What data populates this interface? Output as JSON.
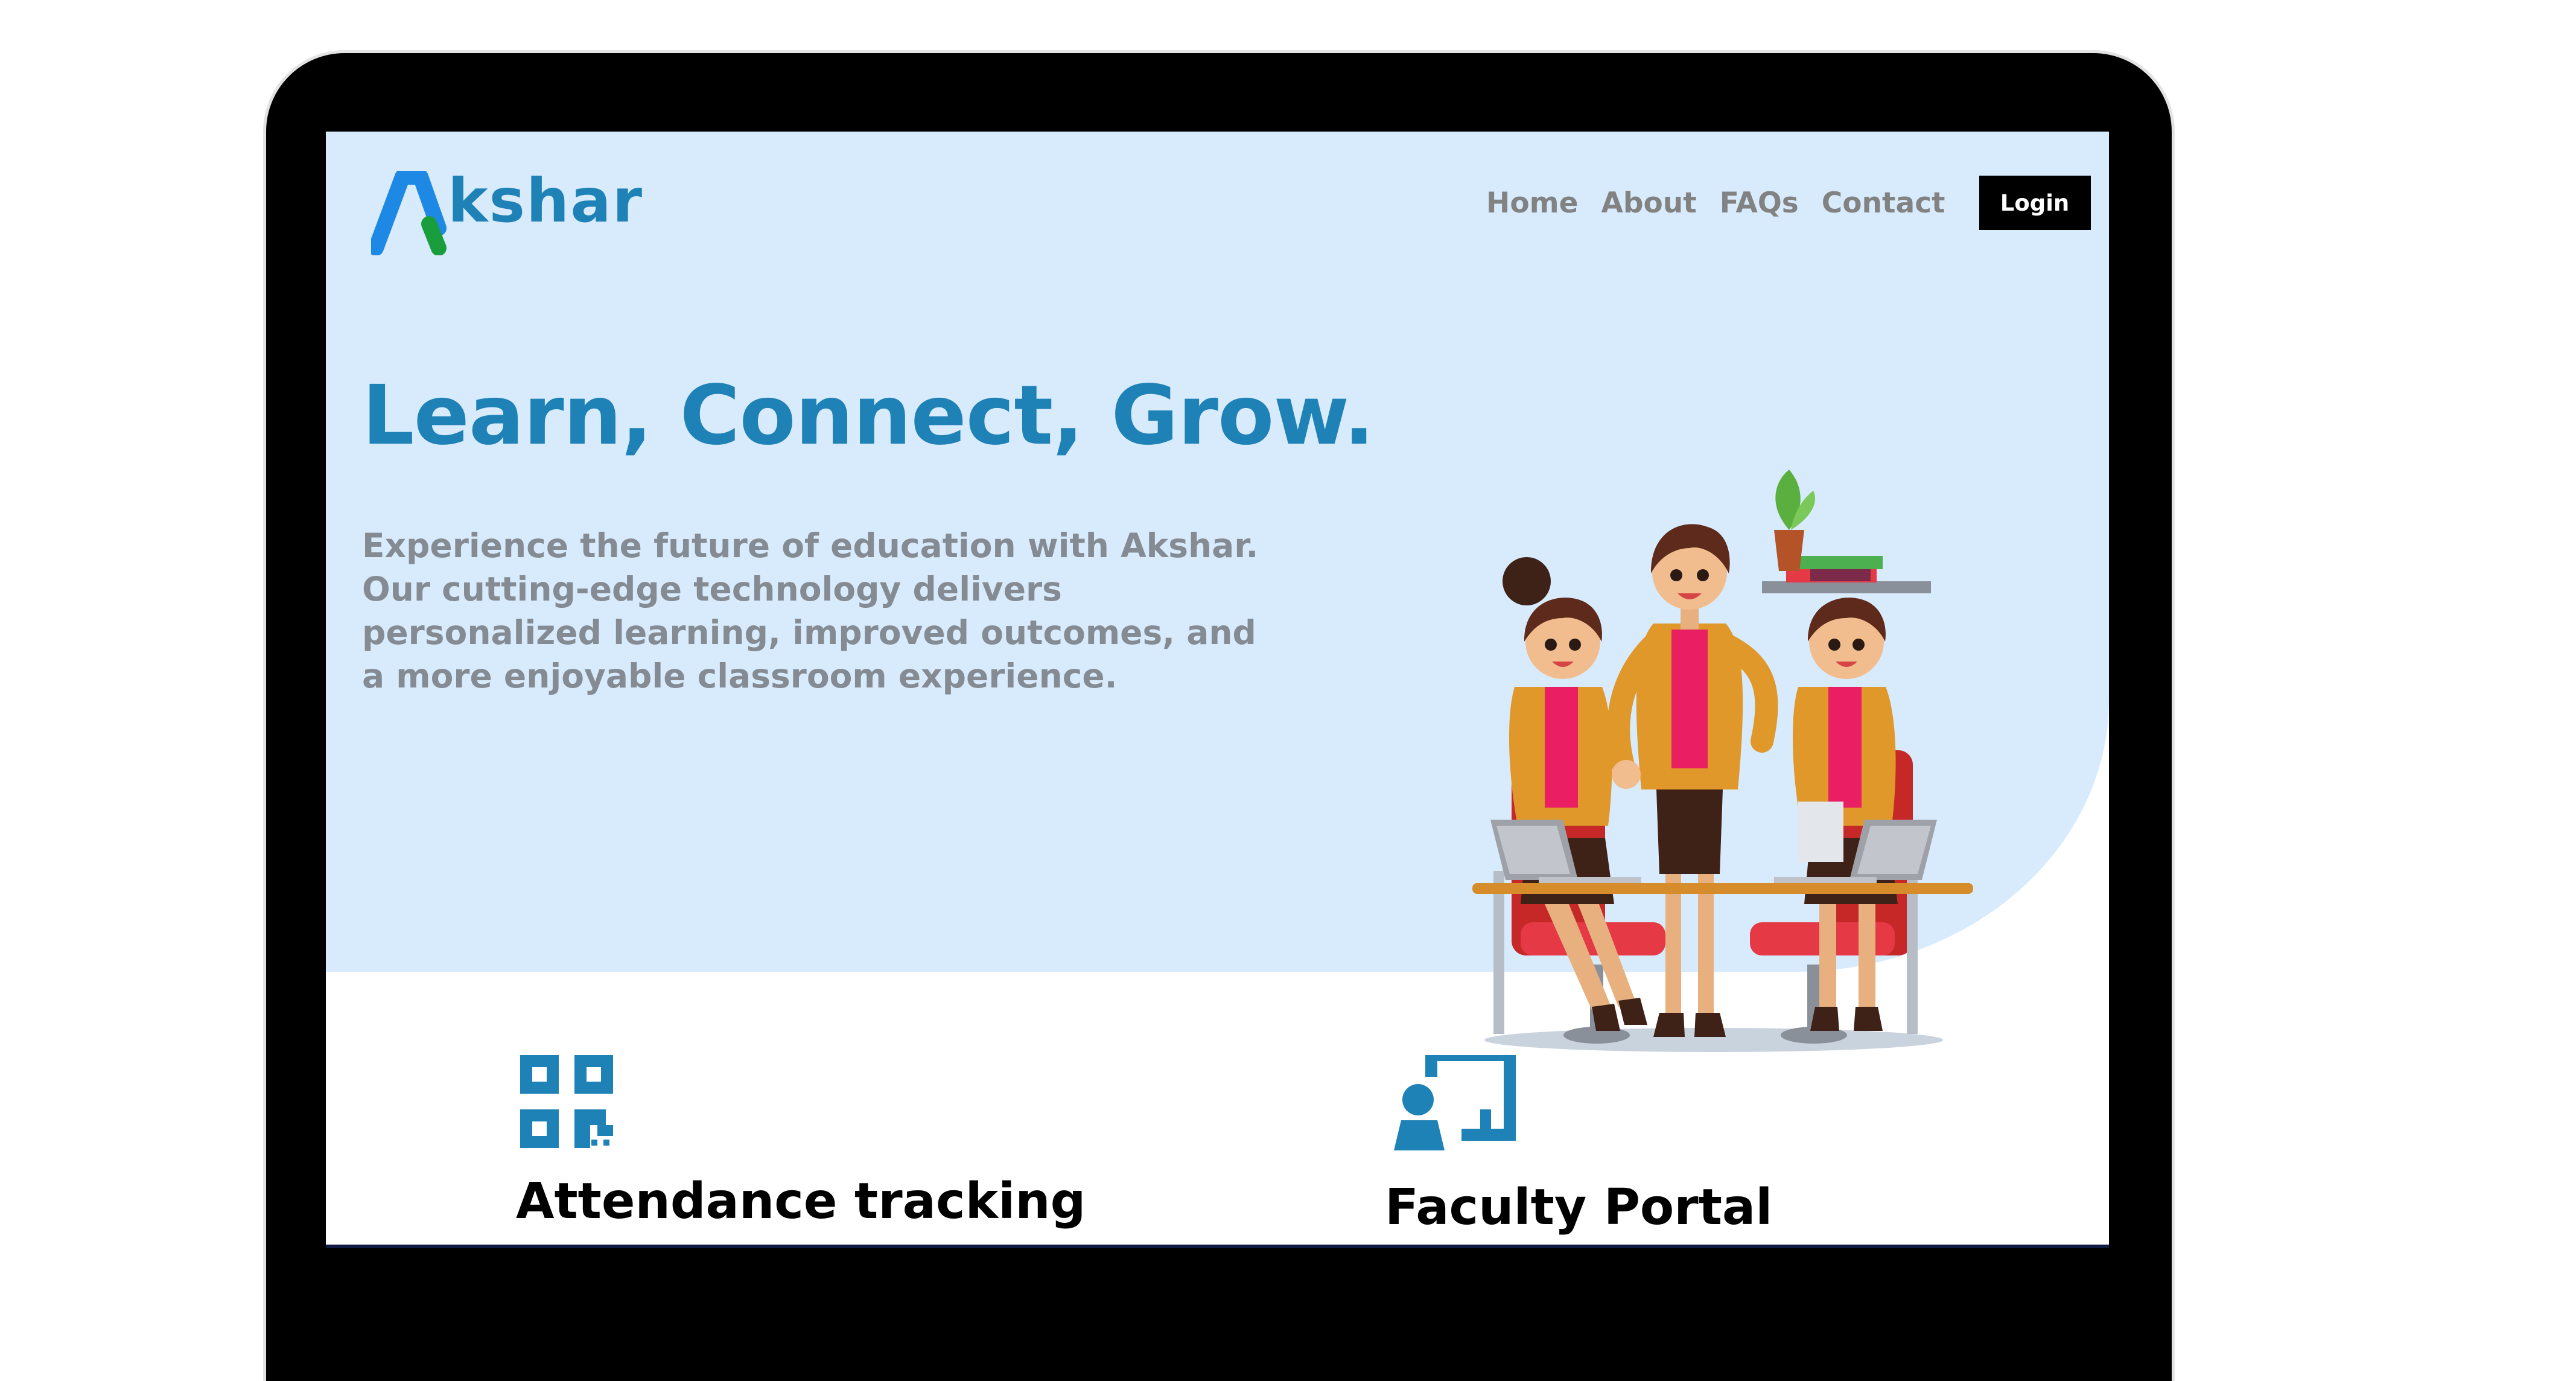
{
  "brand": {
    "name": "kshar",
    "logo_mark": "A",
    "primary_color": "#1f82b6",
    "accent_green": "#1a9d3d"
  },
  "nav": {
    "links": [
      "Home",
      "About",
      "FAQs",
      "Contact"
    ],
    "login_label": "Login"
  },
  "hero": {
    "title": "Learn, Connect, Grow.",
    "description": "Experience the future of education with Akshar. Our cutting-edge technology delivers personalized learning, improved outcomes, and a more enjoyable classroom experience.",
    "background": "#d8ebfd"
  },
  "features": [
    {
      "icon": "qr-code-icon",
      "title": "Attendance tracking"
    },
    {
      "icon": "presentation-icon",
      "title": "Faculty Portal"
    }
  ]
}
